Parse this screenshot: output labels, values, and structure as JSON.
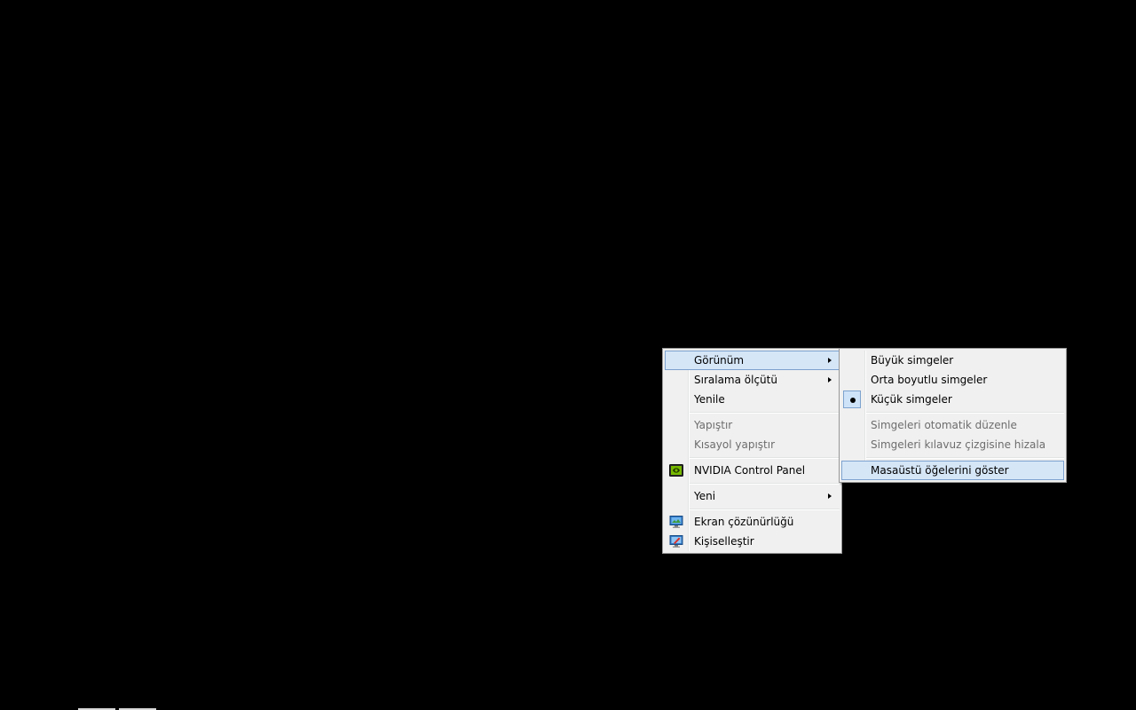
{
  "context_menu": {
    "items": [
      {
        "label": "Görünüm"
      },
      {
        "label": "Sıralama ölçütü"
      },
      {
        "label": "Yenile"
      },
      {
        "label": "Yapıştır"
      },
      {
        "label": "Kısayol yapıştır"
      },
      {
        "label": "NVIDIA Control Panel",
        "icon": "nvidia-icon"
      },
      {
        "label": "Yeni"
      },
      {
        "label": "Ekran çözünürlüğü",
        "icon": "display-resolution-icon"
      },
      {
        "label": "Kişiselleştir",
        "icon": "personalize-icon"
      }
    ]
  },
  "view_submenu": {
    "items": [
      {
        "label": "Büyük simgeler"
      },
      {
        "label": "Orta boyutlu simgeler"
      },
      {
        "label": "Küçük simgeler",
        "selected": true
      },
      {
        "label": "Simgeleri otomatik düzenle"
      },
      {
        "label": "Simgeleri kılavuz çizgisine hizala"
      },
      {
        "label": "Masaüstü öğelerini göster"
      }
    ]
  },
  "colors": {
    "desktop_background": "#000000",
    "menu_background": "#f0f0f0",
    "highlight_fill": "#d5e6f7",
    "highlight_border": "#7da2ce",
    "disabled_text": "#6d6d6d"
  }
}
